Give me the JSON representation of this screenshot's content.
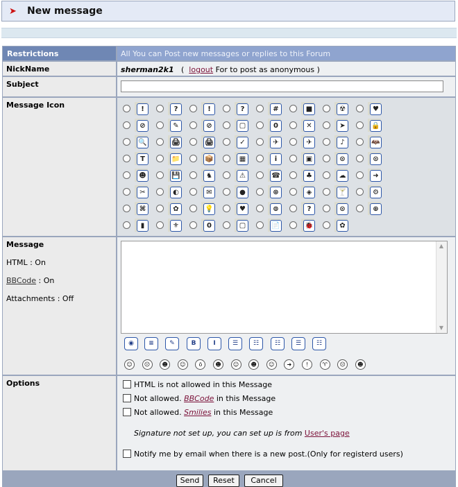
{
  "title": "New message",
  "restrictions": {
    "label": "Restrictions",
    "text": "All You can Post new messages or replies to this Forum"
  },
  "nickname": {
    "label": "NickName",
    "user": "sherman2k1",
    "open_paren": "(",
    "logout_link": "logout",
    "rest": "For to post as anonymous )"
  },
  "subject": {
    "label": "Subject",
    "value": ""
  },
  "message_icon": {
    "label": "Message Icon",
    "icons": [
      [
        "!",
        "?",
        "!",
        "?",
        "#",
        "■",
        "☢",
        "♥"
      ],
      [
        "⊘",
        "✎",
        "⊘",
        "▢",
        "0",
        "✕",
        "➤",
        "🔒"
      ],
      [
        "🔍",
        "🖨",
        "🖨",
        "✓",
        "✈",
        "✈",
        "♪",
        "🦇"
      ],
      [
        "T",
        "📁",
        "📦",
        "▦",
        "i",
        "▣",
        "⊙",
        "⊙"
      ],
      [
        "☻",
        "💾",
        "♞",
        "⚠",
        "☎",
        "♣",
        "☁",
        "➜"
      ],
      [
        "✂",
        "◐",
        "✉",
        "●",
        "⊛",
        "◈",
        "🍸",
        "⚙"
      ],
      [
        "⌘",
        "✿",
        "💡",
        "♥",
        "⊚",
        "?",
        "⊙",
        "⊕"
      ],
      [
        "▮",
        "⚜",
        "0",
        "▢",
        "📄",
        "🐞",
        "✿"
      ]
    ]
  },
  "message": {
    "label": "Message",
    "html_status": "HTML : On",
    "bbcode_link": "BBCode",
    "bbcode_status": " : On",
    "attachments": "Attachments : Off",
    "body": ""
  },
  "toolbar": {
    "buttons": [
      {
        "name": "image-button",
        "glyph": "◉"
      },
      {
        "name": "quote-button",
        "glyph": "≡"
      },
      {
        "name": "edit-button",
        "glyph": "✎"
      },
      {
        "name": "bold-button",
        "glyph": "B"
      },
      {
        "name": "italic-button",
        "glyph": "I"
      },
      {
        "name": "align-center-button",
        "glyph": "☰"
      },
      {
        "name": "list-button",
        "glyph": "☷"
      },
      {
        "name": "ordered-list-button",
        "glyph": "☷"
      },
      {
        "name": "bullet-list-button",
        "glyph": "☰"
      },
      {
        "name": "indent-list-button",
        "glyph": "☷"
      }
    ]
  },
  "smilies": [
    {
      "name": "smile-icon",
      "g": "☺"
    },
    {
      "name": "sad-icon",
      "g": "☹"
    },
    {
      "name": "grin-icon",
      "g": "☻"
    },
    {
      "name": "wink-icon",
      "g": "☺"
    },
    {
      "name": "shock-icon",
      "g": "ö"
    },
    {
      "name": "cool-icon",
      "g": "☻"
    },
    {
      "name": "tongue-icon",
      "g": "☺"
    },
    {
      "name": "laugh-icon",
      "g": "☻"
    },
    {
      "name": "blush-icon",
      "g": "☺"
    },
    {
      "name": "arrow-icon",
      "g": "➜"
    },
    {
      "name": "exclaim-icon",
      "g": "!"
    },
    {
      "name": "devil-icon",
      "g": "♈"
    },
    {
      "name": "confused-icon",
      "g": "☹"
    },
    {
      "name": "big-grin-icon",
      "g": "☻"
    }
  ],
  "options": {
    "label": "Options",
    "html_text": "HTML is not allowed in this Message",
    "bbcode_prefix": "Not allowed. ",
    "bbcode_link": "BBCode",
    "bbcode_suffix": " in this Message",
    "smilies_prefix": "Not allowed. ",
    "smilies_link": "Smilies",
    "smilies_suffix": " in this Message",
    "signature_text": "Signature not set up, you can set up is from ",
    "signature_link": "User's page",
    "notify_text": "Notify me by email when there is a new post.(Only for registerd users)"
  },
  "buttons": {
    "send": "Send",
    "reset": "Reset",
    "cancel": "Cancel"
  }
}
